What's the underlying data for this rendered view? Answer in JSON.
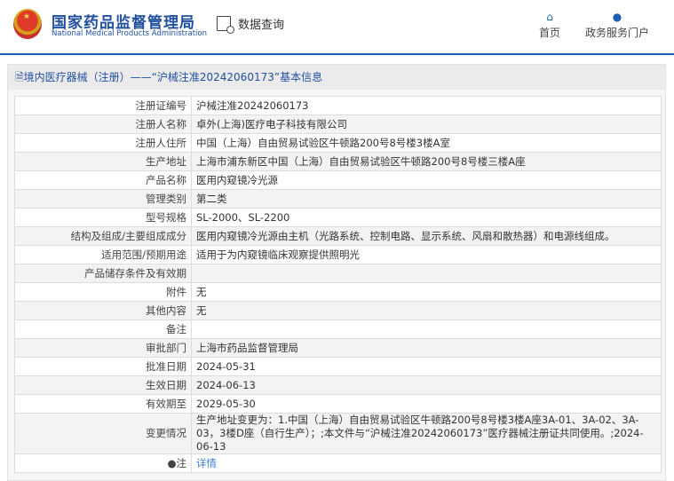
{
  "header": {
    "title_cn": "国家药品监督管理局",
    "title_en": "National Medical Products Administration",
    "query": "数据查询",
    "nav": [
      {
        "label": "首页",
        "icon": "home-icon"
      },
      {
        "label": "政务服务门户",
        "icon": "user-icon"
      }
    ]
  },
  "panel": {
    "title": "境内医疗器械（注册）——“沪械注准20242060173”基本信息"
  },
  "rows": [
    {
      "label": "注册证编号",
      "value": "沪械注准20242060173"
    },
    {
      "label": "注册人名称",
      "value": "卓外(上海)医疗电子科技有限公司"
    },
    {
      "label": "注册人住所",
      "value": "中国（上海）自由贸易试验区牛顿路200号8号楼3楼A室"
    },
    {
      "label": "生产地址",
      "value": "上海市浦东新区中国（上海）自由贸易试验区牛顿路200号8号楼三楼A座"
    },
    {
      "label": "产品名称",
      "value": "医用内窥镜冷光源"
    },
    {
      "label": "管理类别",
      "value": "第二类"
    },
    {
      "label": "型号规格",
      "value": "SL-2000、SL-2200"
    },
    {
      "label": "结构及组成/主要组成成分",
      "value": "医用内窥镜冷光源由主机（光路系统、控制电路、显示系统、风扇和散热器）和电源线组成。"
    },
    {
      "label": "适用范围/预期用途",
      "value": "适用于为内窥镜临床观察提供照明光"
    },
    {
      "label": "产品储存条件及有效期",
      "value": ""
    },
    {
      "label": "附件",
      "value": "无"
    },
    {
      "label": "其他内容",
      "value": "无"
    },
    {
      "label": "备注",
      "value": ""
    },
    {
      "label": "审批部门",
      "value": "上海市药品监督管理局"
    },
    {
      "label": "批准日期",
      "value": "2024-05-31"
    },
    {
      "label": "生效日期",
      "value": "2024-06-13"
    },
    {
      "label": "有效期至",
      "value": "2029-05-30"
    },
    {
      "label": "变更情况",
      "value": "生产地址变更为：1.中国（上海）自由贸易试验区牛顿路200号8号楼3楼A座3A-01、3A-02、3A-03，3楼D座（自行生产）；;本文件与“沪械注准20242060173”医疗器械注册证共同使用。;2024-06-13"
    }
  ],
  "note": {
    "label": "注",
    "link": "详情"
  }
}
